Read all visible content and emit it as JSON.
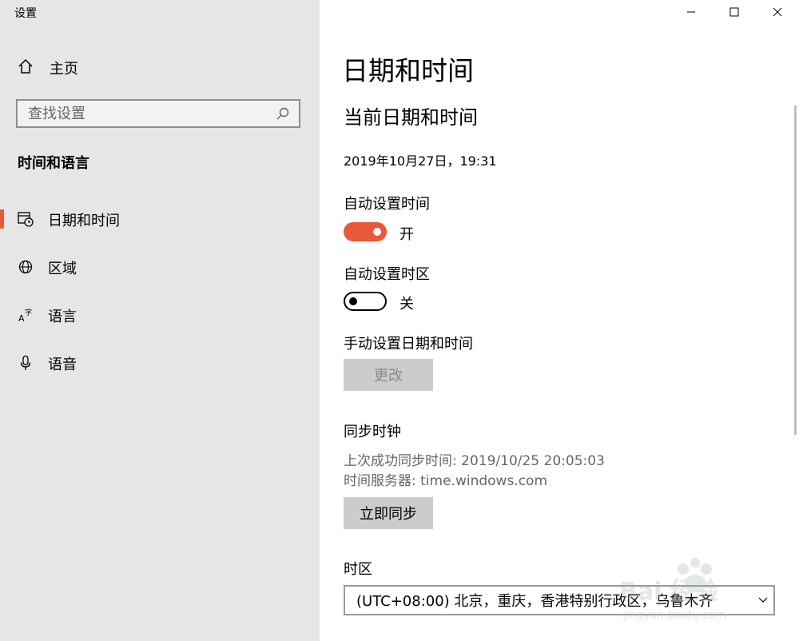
{
  "app": {
    "title": "设置"
  },
  "sidebar": {
    "home_label": "主页",
    "search_placeholder": "查找设置",
    "section_title": "时间和语言",
    "items": [
      {
        "label": "日期和时间",
        "icon": "calendar-clock-icon",
        "active": true
      },
      {
        "label": "区域",
        "icon": "globe-icon",
        "active": false
      },
      {
        "label": "语言",
        "icon": "language-icon",
        "active": false
      },
      {
        "label": "语音",
        "icon": "microphone-icon",
        "active": false
      }
    ]
  },
  "main": {
    "page_title": "日期和时间",
    "section_title": "当前日期和时间",
    "current_datetime": "2019年10月27日，19:31",
    "auto_time": {
      "label": "自动设置时间",
      "state_text": "开",
      "on": true
    },
    "auto_timezone": {
      "label": "自动设置时区",
      "state_text": "关",
      "on": false
    },
    "manual": {
      "label": "手动设置日期和时间",
      "button": "更改"
    },
    "sync": {
      "label": "同步时钟",
      "last_sync": "上次成功同步时间: 2019/10/25 20:05:03",
      "server": "时间服务器: time.windows.com",
      "button": "立即同步"
    },
    "timezone": {
      "label": "时区",
      "value": "(UTC+08:00) 北京，重庆，香港特别行政区，乌鲁木齐"
    }
  },
  "watermark": {
    "text": "Bai 经验",
    "url_text": "jingyan.baidu.com"
  },
  "colors": {
    "accent": "#e8593b",
    "sidebar_bg": "#e6e6e6"
  }
}
